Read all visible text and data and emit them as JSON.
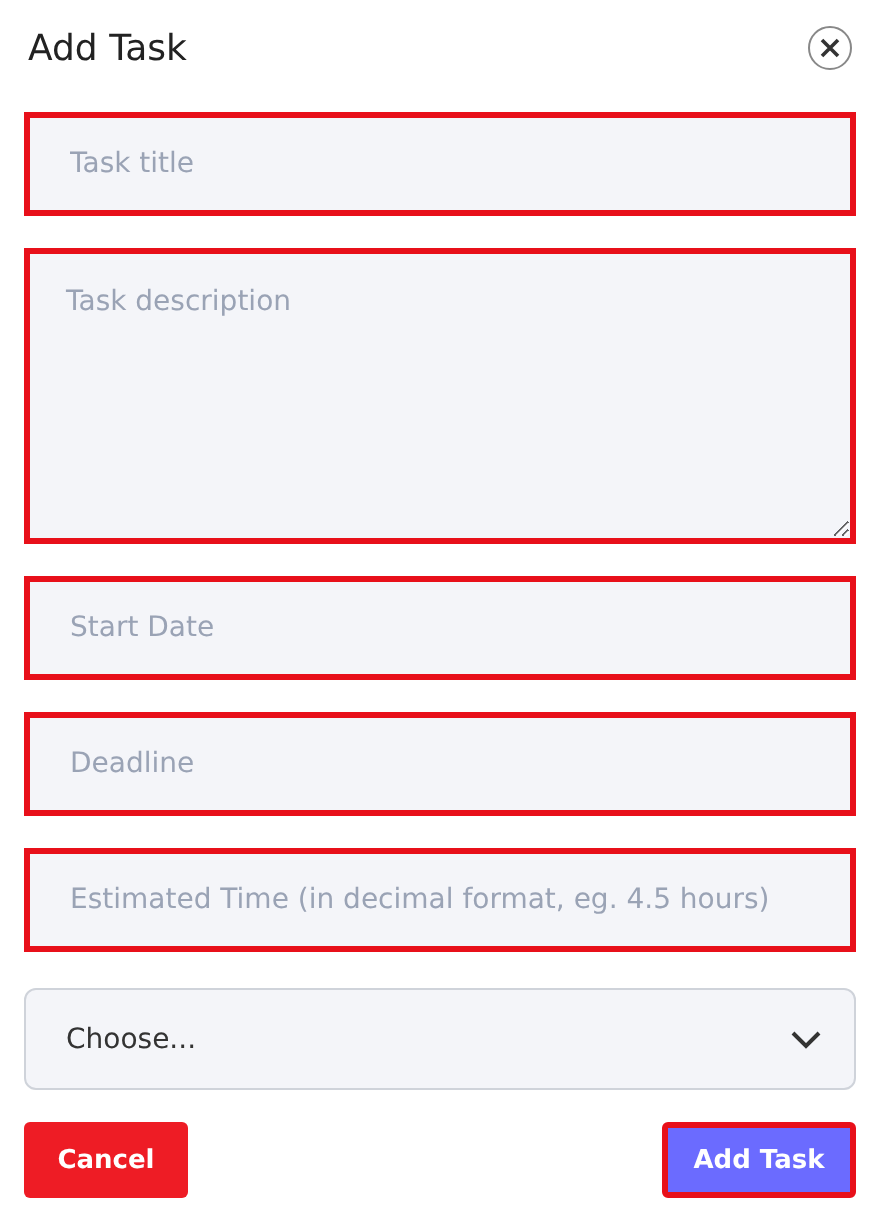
{
  "title": "Add Task",
  "fields": [
    {
      "kind": "input",
      "placeholder": "Task title"
    },
    {
      "kind": "textarea",
      "placeholder": "Task description"
    },
    {
      "kind": "input",
      "placeholder": "Start Date"
    },
    {
      "kind": "input",
      "placeholder": "Deadline"
    },
    {
      "kind": "input",
      "placeholder": "Estimated Time (in decimal format, eg. 4.5 hours)"
    }
  ],
  "select": {
    "value": "Choose..."
  },
  "buttons": [
    {
      "kind": "cancel",
      "label": "Cancel"
    },
    {
      "kind": "submit",
      "label": "Add Task"
    }
  ]
}
